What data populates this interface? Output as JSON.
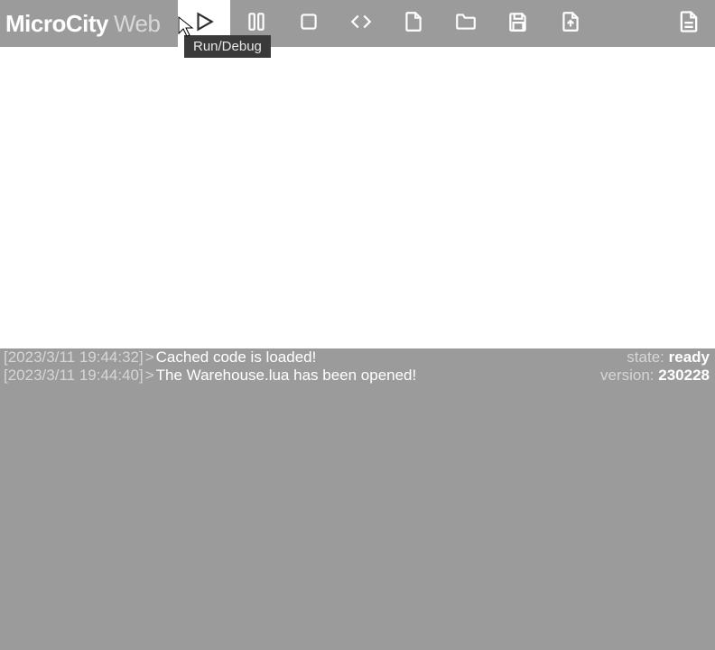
{
  "brand": {
    "name": "MicroCity",
    "sub": "Web"
  },
  "toolbar": {
    "buttons": [
      {
        "name": "run-debug-button",
        "icon": "play-icon",
        "active": true,
        "tooltip": "Run/Debug"
      },
      {
        "name": "pause-button",
        "icon": "pause-icon",
        "active": false
      },
      {
        "name": "stop-button",
        "icon": "stop-icon",
        "active": false
      },
      {
        "name": "code-button",
        "icon": "code-icon",
        "active": false
      },
      {
        "name": "new-file-button",
        "icon": "file-icon",
        "active": false
      },
      {
        "name": "open-folder-button",
        "icon": "folder-icon",
        "active": false
      },
      {
        "name": "save-button",
        "icon": "save-icon",
        "active": false
      },
      {
        "name": "export-button",
        "icon": "file-export-icon",
        "active": false
      }
    ],
    "right_button": {
      "name": "doc-button",
      "icon": "document-icon"
    },
    "tooltip_text": "Run/Debug"
  },
  "console": {
    "logs": [
      {
        "ts": "[2023/3/11 19:44:32]",
        "msg": "Cached code is loaded!"
      },
      {
        "ts": "[2023/3/11 19:44:40]",
        "msg": "The Warehouse.lua has been opened!"
      }
    ]
  },
  "status": {
    "state_label": "state:",
    "state_value": "ready",
    "version_label": "version:",
    "version_value": "230228"
  }
}
